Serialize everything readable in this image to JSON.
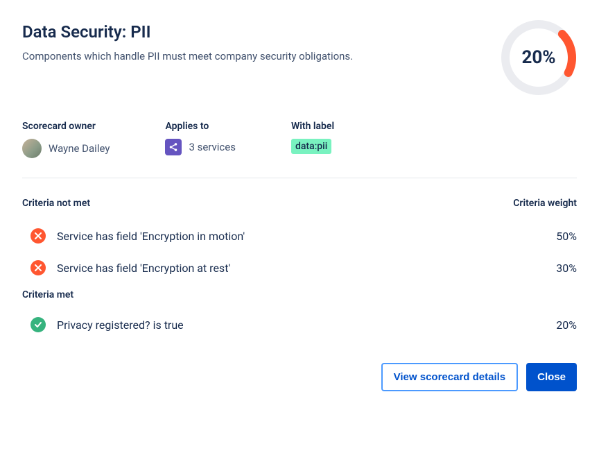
{
  "title": "Data Security: PII",
  "description": "Components which handle PII must meet company security obligations.",
  "progress": {
    "percent": 20,
    "display": "20%",
    "color": "#FF5630",
    "track": "#EBECF0"
  },
  "meta": {
    "owner_label": "Scorecard owner",
    "owner_name": "Wayne Dailey",
    "applies_label": "Applies to",
    "applies_value": "3 services",
    "with_label_label": "With label",
    "with_label_value": "data:pii"
  },
  "criteria": {
    "not_met_heading": "Criteria not met",
    "weight_heading": "Criteria weight",
    "met_heading": "Criteria met",
    "not_met": [
      {
        "text": "Service has field 'Encryption in motion'",
        "weight": "50%"
      },
      {
        "text": "Service has field 'Encryption at rest'",
        "weight": "30%"
      }
    ],
    "met": [
      {
        "text": "Privacy registered? is true",
        "weight": "20%"
      }
    ]
  },
  "buttons": {
    "view_details": "View scorecard details",
    "close": "Close"
  }
}
